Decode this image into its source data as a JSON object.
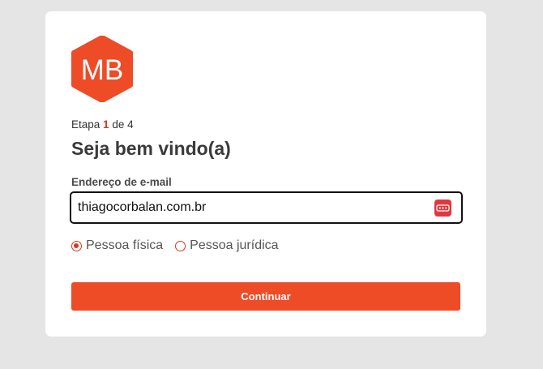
{
  "logo": {
    "text": "MB",
    "color": "#ee4b27"
  },
  "step": {
    "prefix": "Etapa",
    "current": "1",
    "middle": "de",
    "total": "4"
  },
  "title": "Seja bem vindo(a)",
  "email": {
    "label": "Endereço de e-mail",
    "value": "thiagocorbalan.com.br",
    "icon": "password-manager-icon"
  },
  "person_type": {
    "options": [
      {
        "label": "Pessoa física",
        "checked": true
      },
      {
        "label": "Pessoa jurídica",
        "checked": false
      }
    ]
  },
  "continue_label": "Continuar",
  "colors": {
    "accent": "#ee4b27",
    "text": "#3a3a3a",
    "background": "#e5e5e5"
  }
}
